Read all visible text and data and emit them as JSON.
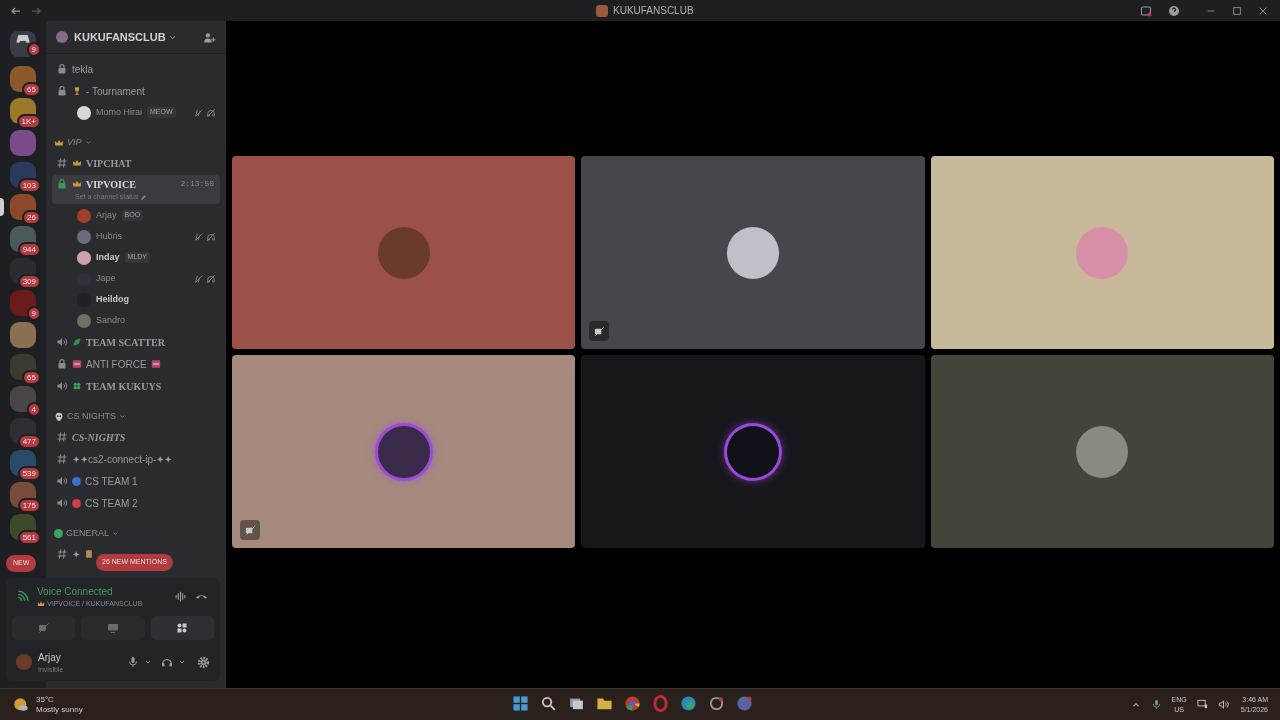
{
  "window": {
    "title": "KUKUFANSCLUB"
  },
  "servers": [
    {
      "badge": "9",
      "color": "#3a3c43"
    },
    {
      "badge": "65",
      "color": "#8a5a2a"
    },
    {
      "badge": "1K+",
      "color": "#9a7a2a"
    },
    {
      "color": "#7a4a8a"
    },
    {
      "badge": "103",
      "color": "#2a3a5a"
    },
    {
      "badge": "26",
      "color": "#8a4a2a",
      "active": true
    },
    {
      "badge": "944",
      "color": "#4a5a5a"
    },
    {
      "badge": "309",
      "color": "#2a2c30"
    },
    {
      "badge": "9",
      "color": "#6a1a1a"
    },
    {
      "color": "#8a7050"
    },
    {
      "badge": "65",
      "color": "#3a3a30"
    },
    {
      "badge": "4",
      "color": "#4a4448"
    },
    {
      "badge": "477",
      "color": "#2e2f33"
    },
    {
      "badge": "539",
      "color": "#2a4a6a"
    },
    {
      "badge": "175",
      "color": "#7a4a3a"
    },
    {
      "badge": "561",
      "color": "#3a4a2a"
    }
  ],
  "new_pill": "NEW",
  "guild": {
    "name": "KUKUFANSCLUB"
  },
  "channels": [
    {
      "kind": "locked",
      "label": "tekla",
      "selected": false
    },
    {
      "kind": "locked",
      "label": "- Tournament",
      "selected": false
    },
    {
      "kind": "user",
      "label": "Momo Hirai",
      "tag": "MEOW",
      "muted": true,
      "bold": false,
      "color": "#d8d8d8"
    },
    {
      "kind": "category",
      "label": "VIP",
      "italic": true
    },
    {
      "kind": "text",
      "label": "VIPCHAT",
      "selected": false,
      "serif": true
    },
    {
      "kind": "locked",
      "label": "VIPVOICE",
      "selected": true,
      "serif": true,
      "timer": "2:13:50",
      "status": "Set a channel status"
    },
    {
      "kind": "user",
      "label": "Arjay",
      "tag": "BOO",
      "muted": false,
      "bold": false,
      "color": "#a0402a"
    },
    {
      "kind": "user",
      "label": "Hubris",
      "muted": true,
      "bold": false,
      "color": "#6a6a80"
    },
    {
      "kind": "user",
      "label": "Inday",
      "tag": "MLDY",
      "muted": false,
      "bold": true,
      "color": "#d0a0b0"
    },
    {
      "kind": "user",
      "label": "Jape",
      "muted": true,
      "bold": false,
      "color": "#303038"
    },
    {
      "kind": "user",
      "label": "Heildog",
      "muted": false,
      "bold": true,
      "color": "#202028"
    },
    {
      "kind": "user",
      "label": "Sandro",
      "muted": false,
      "bold": false,
      "color": "#707060"
    },
    {
      "kind": "voice",
      "label": "TEAM SCATTER",
      "selected": false,
      "serif": true
    },
    {
      "kind": "locked",
      "label": "ANTI FORCE",
      "selected": false
    },
    {
      "kind": "voice",
      "label": "TEAM KUKUYS",
      "selected": false,
      "serif": true
    },
    {
      "kind": "category",
      "label": "CS NIGHTS",
      "italic": false
    },
    {
      "kind": "text",
      "label": "CS-NIGHTS",
      "selected": false,
      "serif": true,
      "italic": true
    },
    {
      "kind": "text",
      "label": "✦✦cs2-connect-ip-✦✦",
      "selected": false
    },
    {
      "kind": "voice",
      "label": "CS TEAM 1",
      "selected": false,
      "color": "#3b6fd0"
    },
    {
      "kind": "voice",
      "label": "CS TEAM 2",
      "selected": false,
      "color": "#d03b4a"
    },
    {
      "kind": "category",
      "label": "GENERAL",
      "color": "#3aa55a",
      "italic": false
    },
    {
      "kind": "text",
      "label": "✦",
      "selected": false
    }
  ],
  "mentions_pill": "26 NEW MENTIONS",
  "voice_panel": {
    "title": "Voice Connected",
    "channel": "VIPVOICE / KUKUFANSCLUB"
  },
  "user_panel": {
    "name": "Arjay",
    "status": "Invisible"
  },
  "tiles": [
    {
      "color": "#9c5148",
      "video_off": false,
      "speaking": false
    },
    {
      "color": "#47464d",
      "video_off": true,
      "speaking": false
    },
    {
      "color": "#c8b99b",
      "video_off": false,
      "speaking": false
    },
    {
      "color": "#a68a7e",
      "video_off": true,
      "speaking": true
    },
    {
      "color": "#17161b",
      "video_off": false,
      "speaking": true
    },
    {
      "color": "#45443b",
      "video_off": false,
      "speaking": false
    }
  ],
  "taskbar": {
    "temperature": "35°C",
    "weather": "Mostly sunny",
    "lang_1": "ENG",
    "lang_2": "US",
    "time": "3:46 AM",
    "date": "5/1/2026"
  }
}
